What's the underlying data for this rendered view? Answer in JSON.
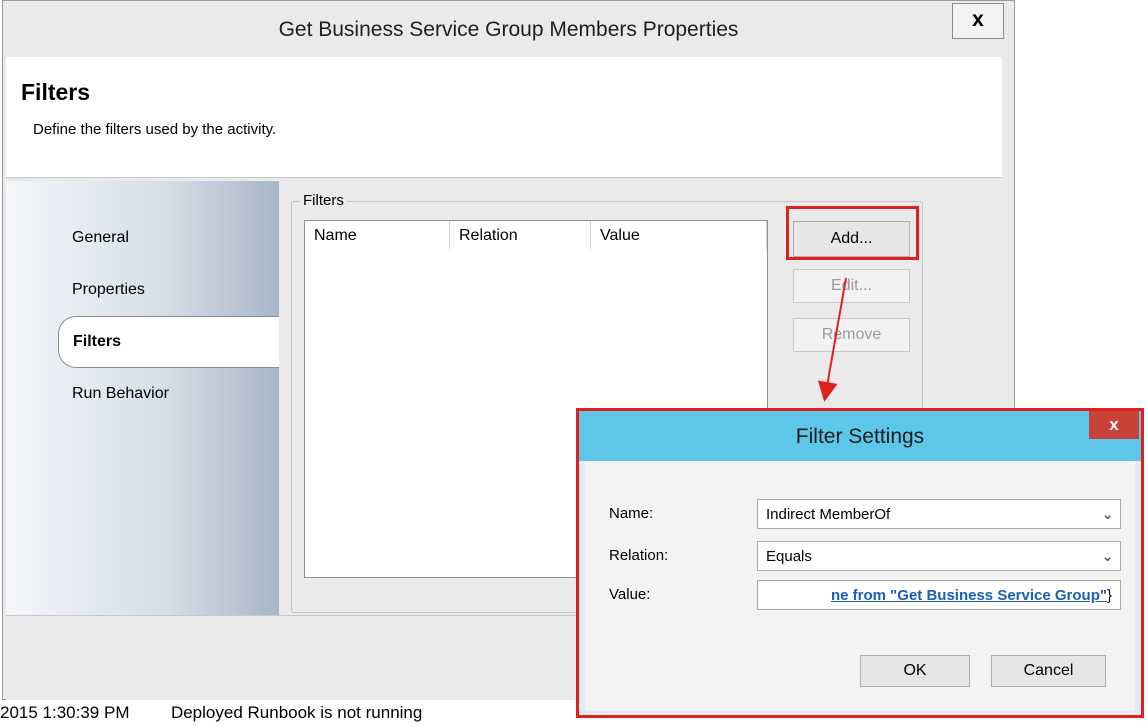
{
  "main_window": {
    "title": "Get Business Service Group Members Properties",
    "close_label": "x"
  },
  "header": {
    "title": "Filters",
    "description": "Define the filters used by the activity."
  },
  "nav": {
    "items": [
      {
        "label": "General"
      },
      {
        "label": "Properties"
      },
      {
        "label": "Filters"
      },
      {
        "label": "Run Behavior"
      }
    ]
  },
  "filters_group": {
    "legend": "Filters",
    "columns": [
      "Name",
      "Relation",
      "Value"
    ],
    "buttons": {
      "add": "Add...",
      "edit": "Edit...",
      "remove": "Remove"
    }
  },
  "status_bar": {
    "timestamp": "2015 1:30:39 PM",
    "message": "Deployed Runbook is not running"
  },
  "filter_dialog": {
    "title": "Filter Settings",
    "close_label": "x",
    "name_label": "Name:",
    "name_value": "Indirect MemberOf",
    "relation_label": "Relation:",
    "relation_value": "Equals",
    "value_label": "Value:",
    "value_text": "ne from \"Get Business Service Group\"",
    "value_suffix": "}",
    "ok_label": "OK",
    "cancel_label": "Cancel"
  },
  "colors": {
    "highlight": "#e0201f",
    "dialog_titlebar": "#5ec6e8",
    "link_text": "#1a5fb4"
  }
}
